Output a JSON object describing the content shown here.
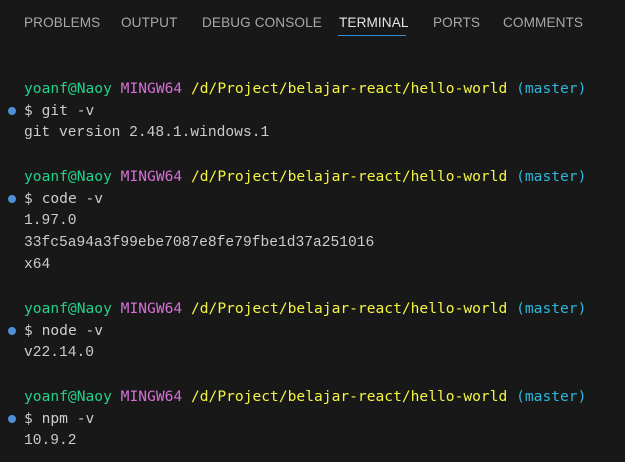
{
  "tabs": [
    {
      "label": "PROBLEMS",
      "active": false
    },
    {
      "label": "OUTPUT",
      "active": false
    },
    {
      "label": "DEBUG CONSOLE",
      "active": false
    },
    {
      "label": "TERMINAL",
      "active": true
    },
    {
      "label": "PORTS",
      "active": false
    },
    {
      "label": "COMMENTS",
      "active": false
    }
  ],
  "colors": {
    "background": "#181818",
    "user": "#23d18b",
    "host": "#d670d6",
    "path": "#f5f543",
    "branch": "#29b8db",
    "text": "#cccccc",
    "active_tab_underline": "#2c8ddc",
    "command_marker": "#4f8fd6"
  },
  "prompt": {
    "user": "yoanf@Naoy",
    "host": "MINGW64",
    "path": "/d/Project/belajar-react/hello-world",
    "branch": "(master)",
    "symbol": "$"
  },
  "blocks": [
    {
      "command": "git -v",
      "output": [
        "git version 2.48.1.windows.1"
      ]
    },
    {
      "command": "code -v",
      "output": [
        "1.97.0",
        "33fc5a94a3f99ebe7087e8fe79fbe1d37a251016",
        "x64"
      ]
    },
    {
      "command": "node -v",
      "output": [
        "v22.14.0"
      ]
    },
    {
      "command": "npm -v",
      "output": [
        "10.9.2"
      ]
    }
  ],
  "icons": {
    "command_marker": "circle-dot-icon"
  }
}
